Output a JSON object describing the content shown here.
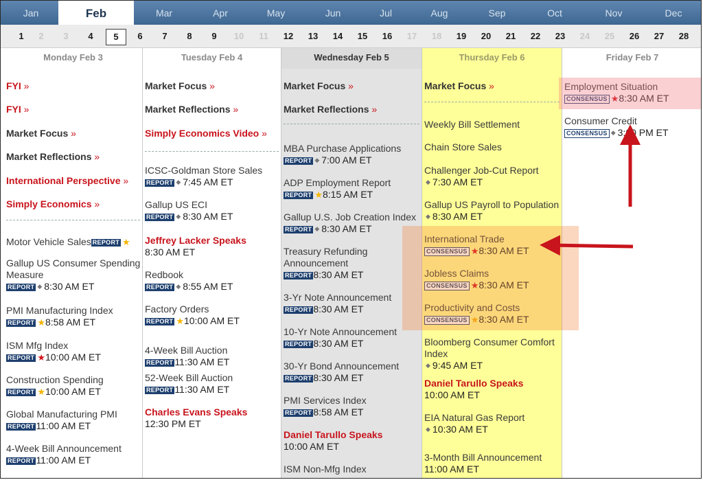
{
  "months": [
    "Jan",
    "Feb",
    "Mar",
    "Apr",
    "May",
    "Jun",
    "Jul",
    "Aug",
    "Sep",
    "Oct",
    "Nov",
    "Dec"
  ],
  "days": [
    "1",
    "2",
    "3",
    "4",
    "5",
    "6",
    "7",
    "8",
    "9",
    "10",
    "11",
    "12",
    "13",
    "14",
    "15",
    "16",
    "17",
    "18",
    "19",
    "20",
    "21",
    "22",
    "23",
    "24",
    "25",
    "26",
    "27",
    "28"
  ],
  "columns": [
    {
      "header": "Monday Feb 3",
      "items": [
        {
          "kind": "link",
          "text": "FYI",
          "red": true
        },
        {
          "kind": "link",
          "text": "FYI",
          "red": true
        },
        {
          "kind": "link",
          "text": "Market Focus",
          "red": false
        },
        {
          "kind": "link",
          "text": "Market Reflections",
          "red": false
        },
        {
          "kind": "link",
          "text": "International Perspective",
          "red": true
        },
        {
          "kind": "link",
          "text": "Simply Economics",
          "red": true
        },
        {
          "kind": "sep"
        },
        {
          "kind": "event",
          "text": "Motor Vehicle Sales",
          "badge": "REPORT",
          "star": "gold",
          "time": "",
          "inline": true
        },
        {
          "kind": "event",
          "text": "Gallup US Consumer Spending Measure",
          "badge": "REPORT",
          "star": "dot",
          "time": "8:30 AM ET"
        },
        {
          "kind": "event",
          "text": "PMI Manufacturing Index",
          "badge": "REPORT",
          "star": "gold",
          "time": "8:58 AM ET"
        },
        {
          "kind": "event",
          "text": "ISM Mfg Index",
          "badge": "REPORT",
          "star": "red",
          "time": "10:00 AM ET"
        },
        {
          "kind": "event",
          "text": "Construction Spending",
          "badge": "REPORT",
          "star": "gold",
          "time": "10:00 AM ET"
        },
        {
          "kind": "event",
          "text": "Global Manufacturing PMI",
          "badge": "REPORT",
          "star": "none",
          "time": "11:00 AM ET"
        },
        {
          "kind": "event",
          "text": "4-Week Bill Announcement",
          "badge": "REPORT",
          "star": "none",
          "time": "11:00 AM ET"
        }
      ]
    },
    {
      "header": "Tuesday Feb 4",
      "items": [
        {
          "kind": "link",
          "text": "Market Focus",
          "red": false
        },
        {
          "kind": "link",
          "text": "Market Reflections",
          "red": false
        },
        {
          "kind": "link",
          "text": "Simply Economics Video",
          "red": true
        },
        {
          "kind": "sep"
        },
        {
          "kind": "event",
          "text": "ICSC-Goldman Store Sales",
          "badge": "REPORT",
          "star": "dot",
          "time": "7:45 AM ET"
        },
        {
          "kind": "event",
          "text": "Gallup US ECI",
          "badge": "REPORT",
          "star": "dot",
          "time": "8:30 AM ET"
        },
        {
          "kind": "speak",
          "text": "Jeffrey Lacker Speaks",
          "time": "8:30 AM ET"
        },
        {
          "kind": "event",
          "text": "Redbook",
          "badge": "REPORT",
          "star": "dot",
          "time": "8:55 AM ET"
        },
        {
          "kind": "event",
          "text": "Factory Orders",
          "badge": "REPORT",
          "star": "gold",
          "time": "10:00 AM ET"
        },
        {
          "kind": "event",
          "text": "4-Week Bill Auction",
          "badge": "REPORT",
          "star": "none",
          "time": "11:30 AM ET"
        },
        {
          "kind": "event",
          "text": "52-Week Bill Auction",
          "badge": "REPORT",
          "star": "none",
          "time": "11:30 AM ET"
        },
        {
          "kind": "speak",
          "text": "Charles Evans Speaks",
          "time": "12:30 PM ET"
        }
      ]
    },
    {
      "header": "Wednesday Feb 5",
      "items": [
        {
          "kind": "link",
          "text": "Market Focus",
          "red": false
        },
        {
          "kind": "link",
          "text": "Market Reflections",
          "red": false
        },
        {
          "kind": "sep"
        },
        {
          "kind": "event",
          "text": "MBA Purchase Applications",
          "badge": "REPORT",
          "star": "dot",
          "time": "7:00 AM ET"
        },
        {
          "kind": "event",
          "text": "ADP Employment Report",
          "badge": "REPORT",
          "star": "gold",
          "time": "8:15 AM ET"
        },
        {
          "kind": "event",
          "text": "Gallup U.S. Job Creation Index",
          "badge": "REPORT",
          "star": "dot",
          "time": "8:30 AM ET"
        },
        {
          "kind": "event",
          "text": "Treasury Refunding Announcement",
          "badge": "REPORT",
          "star": "none",
          "time": "8:30 AM ET"
        },
        {
          "kind": "event",
          "text": "3-Yr Note Announcement",
          "badge": "REPORT",
          "star": "none",
          "time": "8:30 AM ET"
        },
        {
          "kind": "event",
          "text": "10-Yr Note Announcement",
          "badge": "REPORT",
          "star": "none",
          "time": "8:30 AM ET"
        },
        {
          "kind": "event",
          "text": "30-Yr Bond Announcement",
          "badge": "REPORT",
          "star": "none",
          "time": "8:30 AM ET"
        },
        {
          "kind": "event",
          "text": "PMI Services Index",
          "badge": "REPORT",
          "star": "none",
          "time": "8:58 AM ET"
        },
        {
          "kind": "speak",
          "text": "Daniel Tarullo Speaks",
          "time": "10:00 AM ET"
        },
        {
          "kind": "event",
          "text": "ISM Non-Mfg Index",
          "badge": "",
          "star": "none",
          "time": ""
        }
      ]
    },
    {
      "header": "Thursday Feb 6",
      "items": [
        {
          "kind": "link",
          "text": "Market Focus",
          "red": false
        },
        {
          "kind": "sep"
        },
        {
          "kind": "plain",
          "text": "Weekly Bill Settlement"
        },
        {
          "kind": "plain",
          "text": "Chain Store Sales"
        },
        {
          "kind": "event",
          "text": "Challenger Job-Cut Report",
          "badge": "",
          "star": "dot",
          "time": "7:30 AM ET"
        },
        {
          "kind": "event",
          "text": "Gallup US Payroll to Population",
          "badge": "",
          "star": "dot",
          "time": "8:30 AM ET"
        },
        {
          "kind": "event",
          "text": "International Trade",
          "badge": "CONSENSUS",
          "star": "red",
          "time": "8:30 AM ET"
        },
        {
          "kind": "event",
          "text": "Jobless Claims",
          "badge": "CONSENSUS",
          "star": "red",
          "time": "8:30 AM ET"
        },
        {
          "kind": "event",
          "text": "Productivity and Costs",
          "badge": "CONSENSUS",
          "star": "gold",
          "time": "8:30 AM ET"
        },
        {
          "kind": "event",
          "text": "Bloomberg Consumer Comfort Index",
          "badge": "",
          "star": "dot",
          "time": "9:45 AM ET"
        },
        {
          "kind": "speak",
          "text": "Daniel Tarullo Speaks",
          "time": "10:00 AM ET"
        },
        {
          "kind": "event",
          "text": "EIA Natural Gas Report",
          "badge": "",
          "star": "dot",
          "time": "10:30 AM ET"
        },
        {
          "kind": "event",
          "text": "3-Month Bill Announcement",
          "badge": "",
          "star": "none",
          "time": "11:00 AM ET"
        }
      ]
    },
    {
      "header": "Friday Feb 7",
      "items": [
        {
          "kind": "event",
          "text": "Employment Situation",
          "badge": "CONSENSUS",
          "star": "red",
          "time": "8:30 AM ET"
        },
        {
          "kind": "event",
          "text": "Consumer Credit",
          "badge": "CONSENSUS",
          "star": "dot",
          "time": "3:00 PM ET"
        }
      ]
    }
  ],
  "colors": {
    "accent_red": "#c8141c",
    "badge_blue": "#1d3f6e",
    "thursday_bg": "#ffff99",
    "highlight_orange": "#f4823c"
  }
}
